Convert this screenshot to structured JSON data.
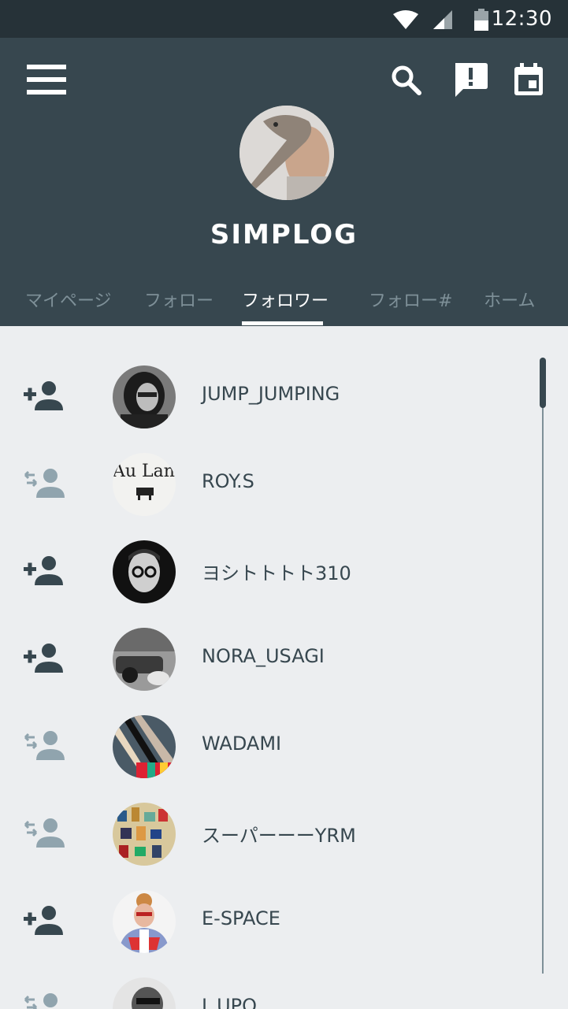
{
  "status_bar": {
    "time": "12:30",
    "icons": [
      "wifi-icon",
      "signal-icon",
      "battery-icon"
    ]
  },
  "header": {
    "title": "SIMPLOG",
    "icons": [
      "menu-icon",
      "search-icon",
      "alert-icon",
      "calendar-icon"
    ],
    "tabs": [
      {
        "label": "マイページ",
        "active": false
      },
      {
        "label": "フォロー",
        "active": false
      },
      {
        "label": "フォロワー",
        "active": true
      },
      {
        "label": "フォロー#",
        "active": false
      },
      {
        "label": "ホーム",
        "active": false
      }
    ]
  },
  "followers": [
    {
      "name": "JUMP_JUMPING",
      "action": "add-person-icon"
    },
    {
      "name": "ROY.S",
      "action": "mutual-follow-icon"
    },
    {
      "name": "ヨシトトトト310",
      "action": "add-person-icon"
    },
    {
      "name": "NORA_USAGI",
      "action": "add-person-icon"
    },
    {
      "name": "WADAMI",
      "action": "mutual-follow-icon"
    },
    {
      "name": "スーパーーーYRM",
      "action": "mutual-follow-icon"
    },
    {
      "name": "E-SPACE",
      "action": "add-person-icon"
    },
    {
      "name": "J_UPO",
      "action": "mutual-follow-icon"
    }
  ],
  "avatar_texts": {
    "roy": "Au Lan"
  },
  "colors": {
    "header_bg": "#37474f",
    "status_bg": "#263238",
    "list_bg": "#eceef0",
    "tab_inactive": "#7e9098",
    "text_dark": "#37474f"
  }
}
